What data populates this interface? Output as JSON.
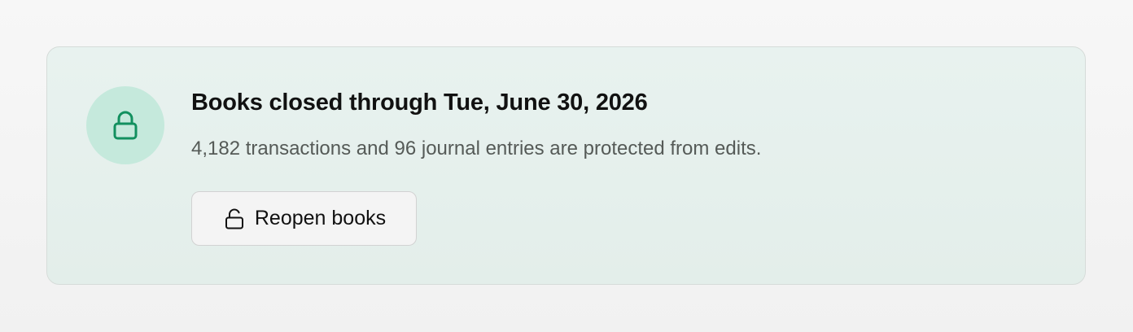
{
  "banner": {
    "icon": "lock-icon",
    "title": "Books closed through Tue, June 30, 2026",
    "description": "4,182 transactions and 96 journal entries are protected from edits.",
    "reopen_button": {
      "label": "Reopen books",
      "icon": "unlock-icon"
    }
  },
  "colors": {
    "accent_green": "#12905f",
    "badge_bg": "#c5e9dc",
    "banner_bg": "#e5f0ec",
    "muted_text": "#555a57"
  }
}
